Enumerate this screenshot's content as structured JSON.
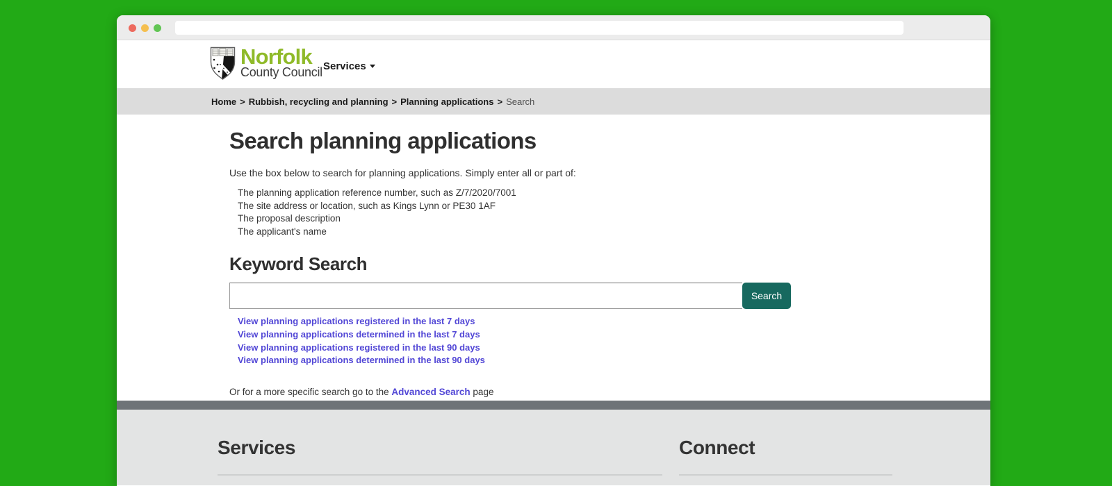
{
  "browser": {
    "address_value": "",
    "window_controls": [
      "close",
      "minimize",
      "zoom"
    ]
  },
  "header": {
    "logo": {
      "line1": "Norfolk",
      "line2": "County Council"
    },
    "nav": {
      "services_label": "Services"
    }
  },
  "breadcrumb": {
    "separator": ">",
    "items": [
      {
        "label": "Home"
      },
      {
        "label": "Rubbish, recycling and planning"
      },
      {
        "label": "Planning applications"
      },
      {
        "label": "Search"
      }
    ]
  },
  "main": {
    "title": "Search planning applications",
    "intro": "Use the box below to search for planning applications. Simply enter all or part of:",
    "criteria": [
      "The planning application reference number, such as Z/7/2020/7001",
      "The site address or location, such as Kings Lynn or PE30 1AF",
      "The proposal description",
      "The applicant's name"
    ],
    "keyword_search": {
      "heading": "Keyword Search",
      "input_value": "",
      "input_placeholder": "",
      "button_label": "Search"
    },
    "quick_links": [
      "View planning applications registered in the last 7 days",
      "View planning applications determined in the last 7 days",
      "View planning applications registered in the last 90 days",
      "View planning applications determined in the last 90 days"
    ],
    "advanced": {
      "prefix": "Or for a more specific search go to the ",
      "link_label": "Advanced Search",
      "suffix": " page"
    }
  },
  "footer": {
    "columns": [
      {
        "heading": "Services"
      },
      {
        "heading": "Connect"
      }
    ]
  },
  "icons": {
    "services_dropdown": "chevron-down",
    "logo_crest": "norfolk-coat-of-arms-shield"
  },
  "colors": {
    "background_green": "#22aa16",
    "norfolk_logo_green": "#8fba29",
    "link_purple": "#5247d6",
    "search_button_teal": "#17695f",
    "breadcrumb_bg": "#dcdcdc",
    "footer_bg": "#e3e4e4",
    "divider_bar": "#6e7378",
    "traffic_red": "#ed6a5e",
    "traffic_yellow": "#f5bf4f",
    "traffic_green": "#61c554"
  }
}
